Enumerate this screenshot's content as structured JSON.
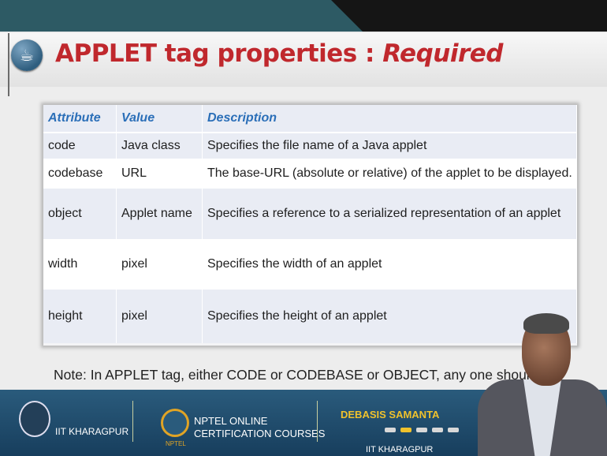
{
  "title": {
    "main": "APPLET tag properties : ",
    "emphasis": "Required"
  },
  "table": {
    "headers": [
      "Attribute",
      "Value",
      "Description"
    ],
    "rows": [
      [
        "code",
        "Java class",
        "Specifies the file name of a Java applet"
      ],
      [
        "codebase",
        "URL",
        "The base-URL (absolute or relative) of the applet to be displayed."
      ],
      [
        "object",
        "Applet name",
        "Specifies a reference to a serialized representation of an applet"
      ],
      [
        "width",
        "pixel",
        "Specifies the width of an applet"
      ],
      [
        "height",
        "pixel",
        "Specifies the height of an applet"
      ]
    ]
  },
  "note": "Note: In APPLET tag, either CODE or CODEBASE or OBJECT, any one should be",
  "footer": {
    "institute": "IIT KHARAGPUR",
    "nptel_line1": "NPTEL ONLINE",
    "nptel_line2": "CERTIFICATION COURSES",
    "nptel_logo_text": "NPTEL",
    "speaker": "DEBASIS SAMANTA",
    "speaker_affiliation": "IIT KHARAGPUR"
  },
  "icons": [
    "java-logo-icon",
    "iit-kharagpur-logo-icon",
    "nptel-logo-icon"
  ],
  "colors": {
    "title_red": "#c0282d",
    "header_blue": "#2b6fb8",
    "footer_blue": "#1f4d6e",
    "speaker_gold": "#f0c22c"
  }
}
